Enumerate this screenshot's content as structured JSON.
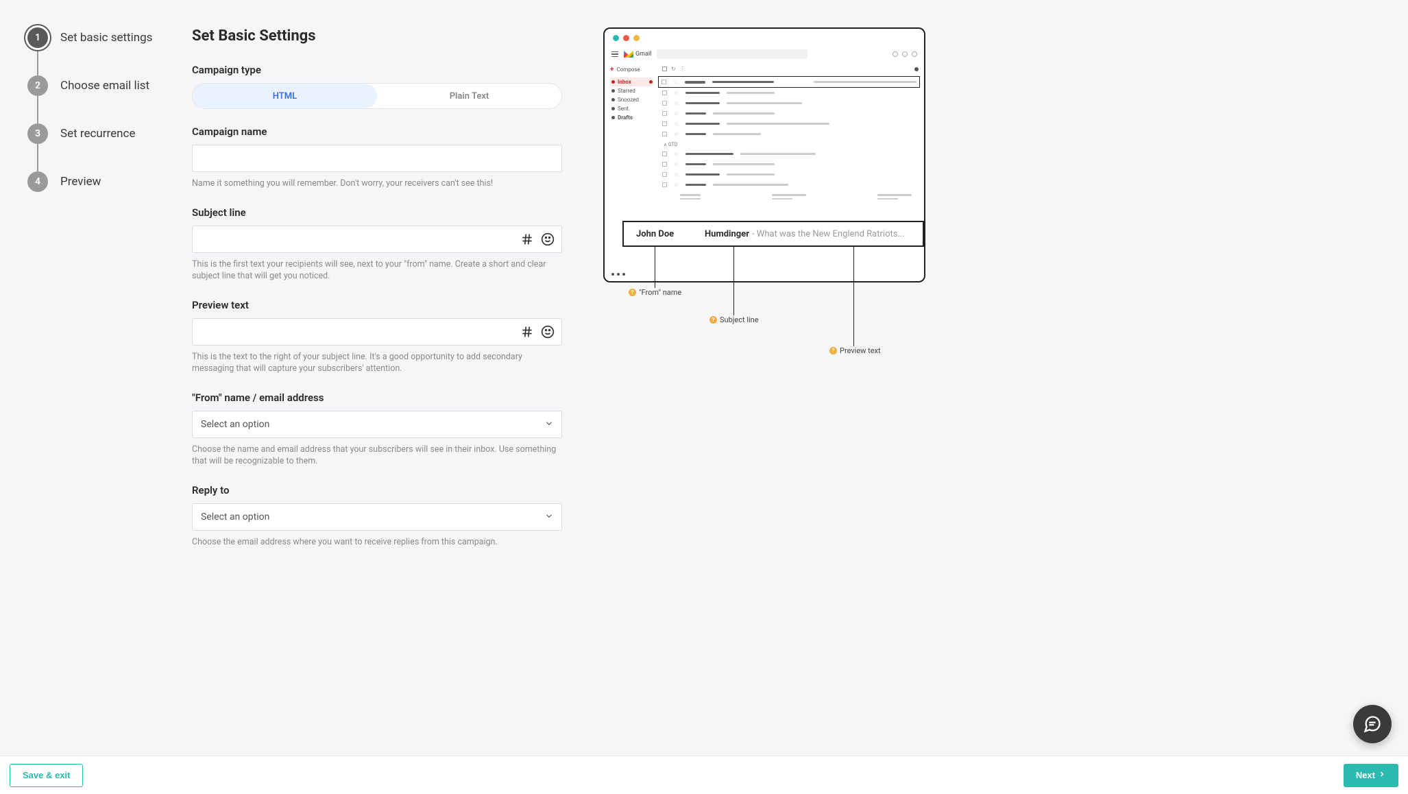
{
  "steps": [
    {
      "num": "1",
      "label": "Set basic settings"
    },
    {
      "num": "2",
      "label": "Choose email list"
    },
    {
      "num": "3",
      "label": "Set recurrence"
    },
    {
      "num": "4",
      "label": "Preview"
    }
  ],
  "page_title": "Set Basic Settings",
  "campaign_type": {
    "label": "Campaign type",
    "options": {
      "html": "HTML",
      "plain": "Plain Text"
    }
  },
  "campaign_name": {
    "label": "Campaign name",
    "value": "",
    "help": "Name it something you will remember. Don't worry, your receivers can't see this!"
  },
  "subject_line": {
    "label": "Subject line",
    "value": "",
    "help": "This is the first text your recipients will see, next to your \"from\" name. Create a short and clear subject line that will get you noticed."
  },
  "preview_text": {
    "label": "Preview text",
    "value": "",
    "help": "This is the text to the right of your subject line. It's a good opportunity to add secondary messaging that will capture your subscribers' attention."
  },
  "from": {
    "label": "\"From\" name / email address",
    "placeholder": "Select an option",
    "help": "Choose the name and email address that your subscribers will see in their inbox. Use something that will be recognizable to them."
  },
  "reply_to": {
    "label": "Reply to",
    "placeholder": "Select an option",
    "help": "Choose the email address where you want to receive replies from this campaign."
  },
  "footer": {
    "save_exit": "Save & exit",
    "next": "Next"
  },
  "preview_illustration": {
    "gmail_brand": "Gmail",
    "compose": "Compose",
    "nav": {
      "inbox": "Inbox",
      "starred": "Starred",
      "snoozed": "Snoozed",
      "sent": "Sent",
      "drafts": "Drafts"
    },
    "gtd": "GTD",
    "popout": {
      "from": "John Doe",
      "subject": "Humdinger",
      "rest": " - What was the New Englend Ratriots..."
    },
    "labels": {
      "from": "\"From\" name",
      "subject": "Subject line",
      "preview": "Preview text"
    }
  }
}
